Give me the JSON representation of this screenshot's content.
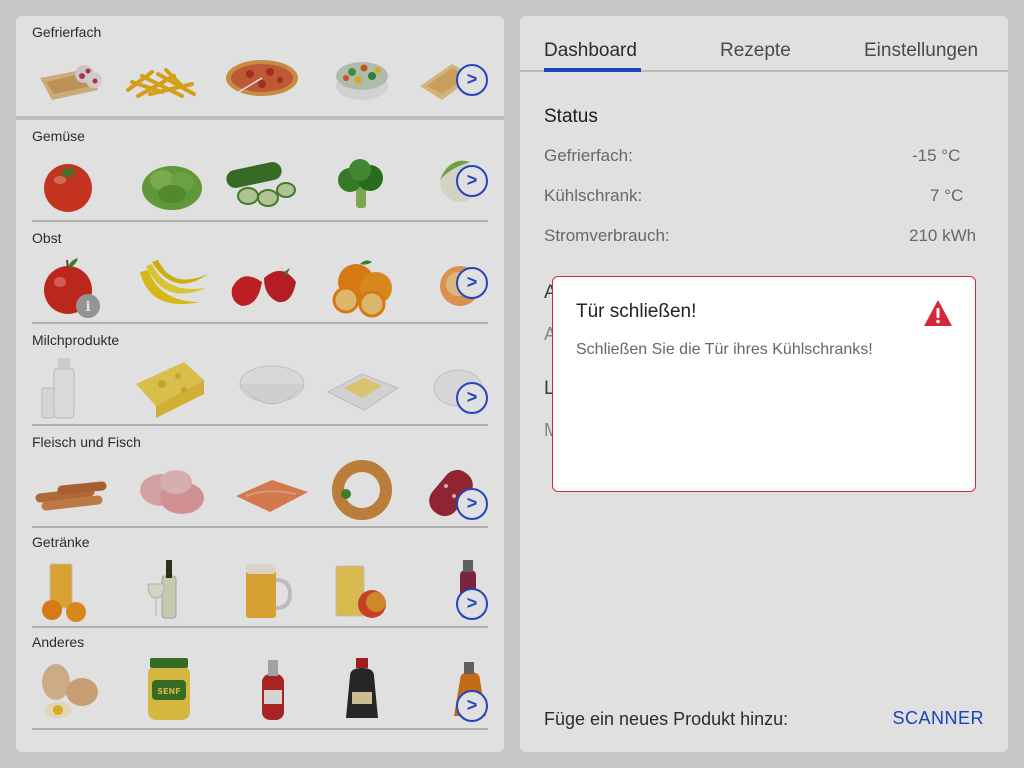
{
  "categories": [
    {
      "title": "Gefrierfach",
      "items": [
        "ice-cream-cone",
        "french-fries",
        "pizza",
        "frozen-vegetables",
        "frozen-dish"
      ]
    },
    {
      "title": "Gemüse",
      "items": [
        "tomato",
        "lettuce",
        "cucumber",
        "broccoli",
        "cauliflower"
      ]
    },
    {
      "title": "Obst",
      "items": [
        "apple",
        "bananas",
        "strawberries",
        "oranges",
        "peaches"
      ]
    },
    {
      "title": "Milchprodukte",
      "items": [
        "milk-bottle",
        "cheese",
        "yogurt",
        "butter",
        "cream"
      ]
    },
    {
      "title": "Fleisch und Fisch",
      "items": [
        "sausages",
        "ham",
        "salmon",
        "ring-sausage",
        "salami"
      ]
    },
    {
      "title": "Getränke",
      "items": [
        "orange-juice",
        "wine",
        "beer",
        "apple-juice",
        "bottle-drink"
      ]
    },
    {
      "title": "Anderes",
      "items": [
        "eggs",
        "mustard",
        "ketchup",
        "soy-sauce",
        "syrup"
      ]
    }
  ],
  "next_button_label": ">",
  "info_badge": "i",
  "tabs": [
    {
      "label": "Dashboard",
      "active": true
    },
    {
      "label": "Rezepte",
      "active": false
    },
    {
      "label": "Einstellungen",
      "active": false
    }
  ],
  "status": {
    "title": "Status",
    "rows": [
      {
        "label": "Gefrierfach:",
        "value": "-15 °C"
      },
      {
        "label": "Kühlschrank:",
        "value": "7 °C"
      },
      {
        "label": "Stromverbrauch:",
        "value": "210 kWh"
      }
    ]
  },
  "hidden_letters": {
    "a1": "A",
    "a2": "A",
    "l": "L",
    "m": "M"
  },
  "bottom": {
    "label": "Füge ein neues Produkt hinzu:",
    "scanner": "SCANNER"
  },
  "dialog": {
    "title": "Tür schließen!",
    "message": "Schließen Sie die Tür ihres Kühlschranks!",
    "icon": "warning-icon",
    "border_color": "#d72638"
  },
  "colors": {
    "accent": "#1d4dd6",
    "warning": "#d72638"
  }
}
